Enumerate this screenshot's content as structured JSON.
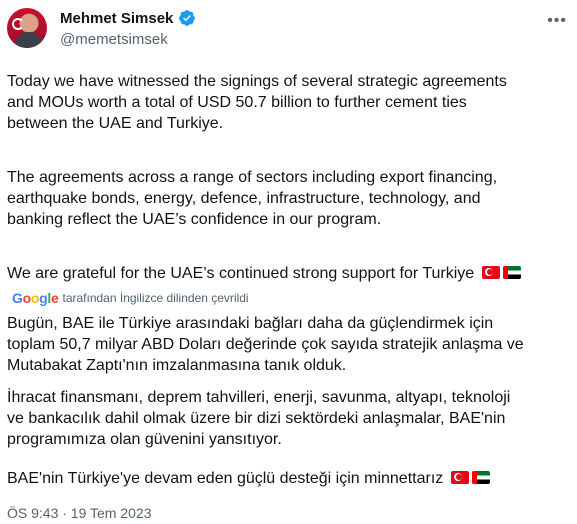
{
  "author": {
    "display_name": "Mehmet Simsek",
    "handle": "@memetsimsek"
  },
  "tweet": {
    "paragraphs": [
      "Today we have witnessed the signings of several strategic agreements\nand MOUs worth a total of USD 50.7 billion to further cement ties\nbetween the UAE and Turkiye.",
      "The agreements across a range of sectors including export financing,\nearthquake bonds, energy, defence, infrastructure, technology, and\nbanking reflect the UAE’s confidence in our program.",
      "We are grateful for the UAE’s continued strong support for Turkiye"
    ],
    "flags": [
      "turkey-flag",
      "uae-flag"
    ]
  },
  "translation": {
    "provider": "Google",
    "note": "tarafından İngilizce dilinden çevrildi",
    "paragraphs": [
      "Bugün, BAE ile Türkiye arasındaki bağları daha da güçlendirmek için\ntoplam 50,7 milyar ABD Doları değerinde çok sayıda stratejik anlaşma ve\nMutabakat Zaptı'nın imzalanmasına tanık olduk.",
      "İhracat finansmanı, deprem tahvilleri, enerji, savunma, altyapı, teknoloji\nve bankacılık dahil olmak üzere bir dizi sektördeki anlaşmalar, BAE'nin\nprogramımıza olan güvenini yansıtıyor.",
      "BAE'nin Türkiye'ye devam eden güçlü desteği için minnettarız"
    ]
  },
  "timestamp": "ÖS 9:43 · 19 Tem 2023",
  "colors": {
    "text": "#0f1419",
    "secondary": "#536471",
    "verified": "#1d9bf0"
  }
}
